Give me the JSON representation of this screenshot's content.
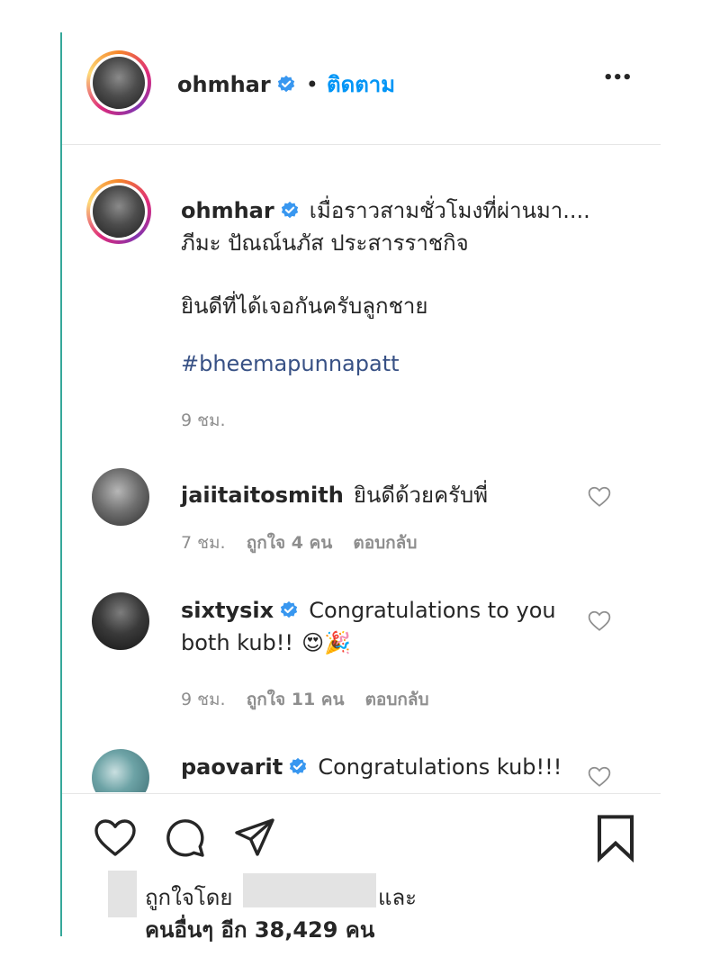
{
  "header": {
    "username": "ohmhar",
    "follow_label": "ติดตาม",
    "separator": "•",
    "more_label": "•••"
  },
  "post": {
    "username": "ohmhar",
    "caption_line1": "เมื่อราวสามชั่วโมงที่ผ่านมา....",
    "caption_line2": "ภีมะ ปัณณ์นภัส ประสารราชกิจ",
    "caption_line3": "ยินดีที่ได้เจอกันครับลูกชาย",
    "hashtag": "#bheemapunnapatt",
    "time": "9 ชม."
  },
  "comments": [
    {
      "username": "jaiitaitosmith",
      "text": "ยินดีด้วยครับพี่",
      "time": "7 ชม.",
      "likes": "ถูกใจ 4 คน",
      "reply": "ตอบกลับ"
    },
    {
      "username": "sixtysix",
      "text_line1": "Congratulations to you",
      "text_line2": "both kub!!",
      "emoji": "😍🎉",
      "time": "9 ชม.",
      "likes": "ถูกใจ 11 คน",
      "reply": "ตอบกลับ"
    },
    {
      "username": "paovarit",
      "text": "Congratulations kub!!!"
    }
  ],
  "likes": {
    "liked_by": "ถูกใจโดย",
    "and": "และ",
    "others": "คนอื่นๆ อีก 38,429 คน"
  },
  "colors": {
    "verified": "#3897f0",
    "link": "#385185",
    "muted": "#8e8e8e",
    "frame_line": "#36a89a"
  },
  "icons": {
    "like": "heart-icon",
    "comment": "comment-bubble-icon",
    "share": "paper-plane-icon",
    "save": "bookmark-icon"
  }
}
